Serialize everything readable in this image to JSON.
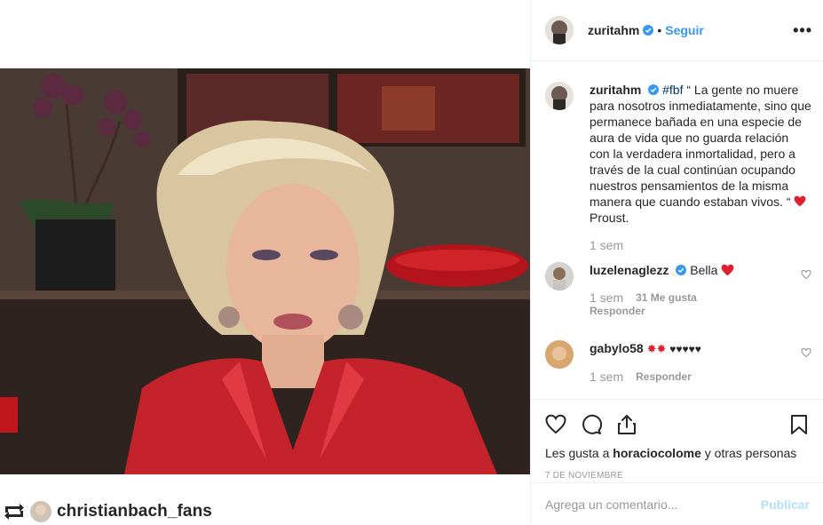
{
  "post": {
    "author": "zuritahm",
    "follow_label": "Seguir",
    "dot": "•",
    "more_label": "•••"
  },
  "caption": {
    "author": "zuritahm",
    "hashtag": "#fbf",
    "text": "“ La gente no muere para nosotros inmediatamente, sino que permanece bañada en una especie de aura de vida que no guarda relación con la verdadera inmortalidad, pero a través de la cual continúan ocupando nuestros pensamientos de la misma manera que cuando estaban vivos. “",
    "text_end": "Proust.",
    "time": "1 sem"
  },
  "comments": [
    {
      "user": "luzelenaglezz",
      "text": "Bella",
      "time": "1 sem",
      "likes": "31 Me gusta",
      "reply": "Responder"
    },
    {
      "user": "gabylo58",
      "text": "♥♥♥♥♥",
      "time": "1 sem",
      "reply": "Responder"
    }
  ],
  "likes": {
    "prefix": "Les gusta a",
    "user": "horaciocolome",
    "suffix": "y otras personas"
  },
  "date": "7 DE NOVIEMBRE",
  "comment_box": {
    "placeholder": "Agrega un comentario...",
    "publish": "Publicar"
  },
  "repost": {
    "user": "christianbach_fans"
  },
  "colors": {
    "link": "#3897f0",
    "heart": "#ed4956",
    "muted": "#999999"
  },
  "icons": [
    "verified-icon",
    "heart-icon",
    "comment-icon",
    "share-icon",
    "bookmark-icon",
    "repost-icon"
  ]
}
